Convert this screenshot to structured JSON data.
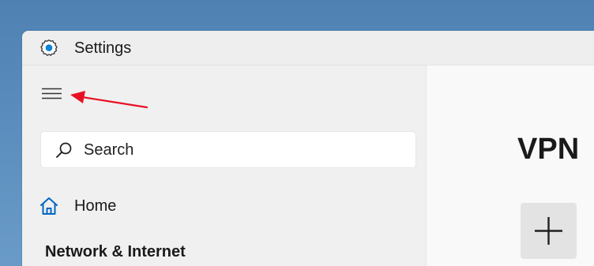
{
  "window": {
    "title": "Settings",
    "app_icon": "settings-gear-icon"
  },
  "sidebar": {
    "menu_icon": "hamburger-menu-icon",
    "search": {
      "placeholder": "Search",
      "icon": "search-icon"
    },
    "nav_items": [
      {
        "label": "Home",
        "icon": "home-icon"
      }
    ],
    "section_title": "Network & Internet"
  },
  "content": {
    "page_title": "VPN",
    "add_tile_icon": "plus-icon"
  },
  "annotation": {
    "type": "arrow",
    "color": "#e81123",
    "points_to": "hamburger-menu-button"
  },
  "colors": {
    "accent": "#0067c0",
    "desktop_background": "#5a8dbd",
    "annotation_red": "#e81123"
  }
}
